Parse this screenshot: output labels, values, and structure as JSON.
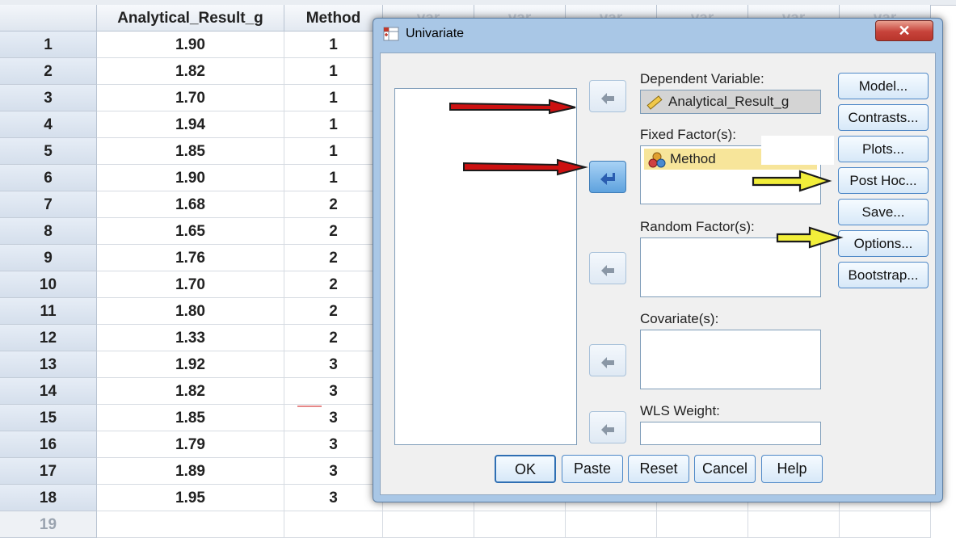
{
  "spreadsheet": {
    "columns": [
      "Analytical_Result_g",
      "Method",
      "var",
      "var",
      "var",
      "var",
      "var",
      "var"
    ],
    "rows": [
      {
        "n": "1",
        "result": "1.90",
        "method": "1"
      },
      {
        "n": "2",
        "result": "1.82",
        "method": "1"
      },
      {
        "n": "3",
        "result": "1.70",
        "method": "1"
      },
      {
        "n": "4",
        "result": "1.94",
        "method": "1"
      },
      {
        "n": "5",
        "result": "1.85",
        "method": "1"
      },
      {
        "n": "6",
        "result": "1.90",
        "method": "1"
      },
      {
        "n": "7",
        "result": "1.68",
        "method": "2"
      },
      {
        "n": "8",
        "result": "1.65",
        "method": "2"
      },
      {
        "n": "9",
        "result": "1.76",
        "method": "2"
      },
      {
        "n": "10",
        "result": "1.70",
        "method": "2"
      },
      {
        "n": "11",
        "result": "1.80",
        "method": "2"
      },
      {
        "n": "12",
        "result": "1.33",
        "method": "2"
      },
      {
        "n": "13",
        "result": "1.92",
        "method": "3"
      },
      {
        "n": "14",
        "result": "1.82",
        "method": "3"
      },
      {
        "n": "15",
        "result": "1.85",
        "method": "3"
      },
      {
        "n": "16",
        "result": "1.79",
        "method": "3"
      },
      {
        "n": "17",
        "result": "1.89",
        "method": "3"
      },
      {
        "n": "18",
        "result": "1.95",
        "method": "3"
      },
      {
        "n": "19",
        "result": "",
        "method": ""
      }
    ]
  },
  "dialog": {
    "title": "Univariate",
    "close_label": "✕",
    "dependent_label": "Dependent Variable:",
    "dependent_value": "Analytical_Result_g",
    "fixed_label": "Fixed Factor(s):",
    "fixed_value": "Method",
    "random_label": "Random Factor(s):",
    "covariate_label": "Covariate(s):",
    "wls_label": "WLS Weight:",
    "side_buttons": [
      "Model...",
      "Contrasts...",
      "Plots...",
      "Post Hoc...",
      "Save...",
      "Options...",
      "Bootstrap..."
    ],
    "bottom_buttons": [
      "OK",
      "Paste",
      "Reset",
      "Cancel",
      "Help"
    ]
  },
  "colors": {
    "dialog_frame": "#a9c7e6",
    "button_border": "#4e88c7",
    "annotation_red": "#cc1111",
    "annotation_yellow": "#f2ee3a"
  }
}
